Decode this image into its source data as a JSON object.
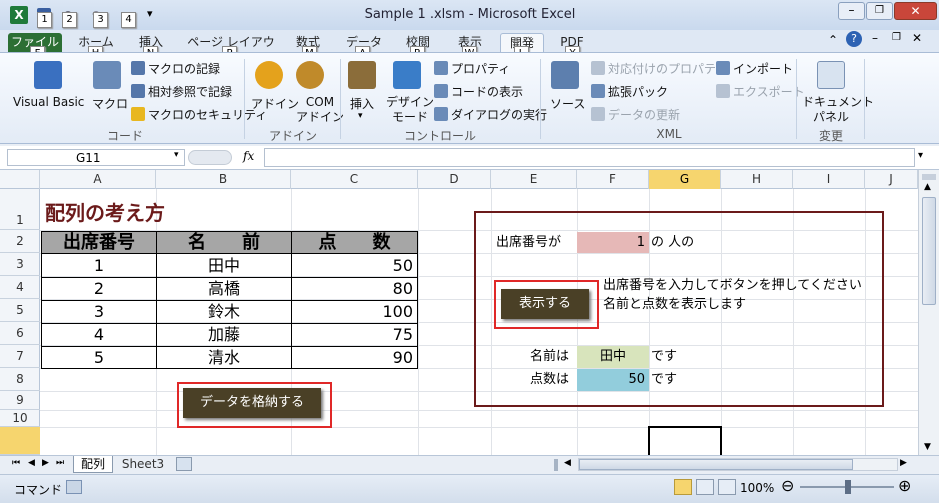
{
  "window": {
    "title": "Sample 1 .xlsm - Microsoft Excel",
    "quick_access_keys": [
      "1",
      "2",
      "3",
      "4"
    ]
  },
  "tabs": [
    {
      "label": "ファイル",
      "key": "F"
    },
    {
      "label": "ホーム",
      "key": "H"
    },
    {
      "label": "挿入",
      "key": "N"
    },
    {
      "label": "ページ レイアウト",
      "key": "P"
    },
    {
      "label": "数式",
      "key": "M"
    },
    {
      "label": "データ",
      "key": "A"
    },
    {
      "label": "校閲",
      "key": "R"
    },
    {
      "label": "表示",
      "key": "W"
    },
    {
      "label": "開発",
      "key": "L"
    },
    {
      "label": "PDF",
      "key": "Y"
    }
  ],
  "ribbon": {
    "code": {
      "group_label": "コード",
      "visual_basic": "Visual Basic",
      "macro": "マクロ",
      "record_macro": "マクロの記録",
      "relative_ref": "相対参照で記録",
      "macro_security": "マクロのセキュリティ"
    },
    "addin": {
      "group_label": "アドイン",
      "addin": "アドイン",
      "com_addin_1": "COM",
      "com_addin_2": "アドイン"
    },
    "control": {
      "group_label": "コントロール",
      "insert": "挿入",
      "design_mode_1": "デザイン",
      "design_mode_2": "モード",
      "properties": "プロパティ",
      "view_code": "コードの表示",
      "run_dialog": "ダイアログの実行"
    },
    "xml": {
      "group_label": "XML",
      "source": "ソース",
      "map_props": "対応付けのプロパティ",
      "expansion_pack": "拡張パック",
      "refresh_data": "データの更新",
      "import": "インポート",
      "export": "エクスポート"
    },
    "modify": {
      "group_label": "変更",
      "doc_panel_1": "ドキュメント",
      "doc_panel_2": "パネル"
    }
  },
  "formula_bar": {
    "name_box": "G11",
    "fx": "fx",
    "value": ""
  },
  "columns": [
    "A",
    "B",
    "C",
    "D",
    "E",
    "F",
    "G",
    "H",
    "I",
    "J"
  ],
  "rows": [
    "1",
    "2",
    "3",
    "4",
    "5",
    "6",
    "7",
    "8",
    "9",
    "10"
  ],
  "sheet": {
    "title": "配列の考え方",
    "headers": [
      "出席番号",
      "名　　前",
      "点　　数"
    ],
    "table": [
      [
        "1",
        "田中",
        "50"
      ],
      [
        "2",
        "高橋",
        "80"
      ],
      [
        "3",
        "鈴木",
        "100"
      ],
      [
        "4",
        "加藤",
        "75"
      ],
      [
        "5",
        "清水",
        "90"
      ]
    ],
    "store_button": "データを格納する",
    "panel": {
      "prompt_label": "出席番号が",
      "prompt_value": "1",
      "prompt_suffix": "の 人の",
      "show_button": "表示する",
      "instruction_1": "出席番号を入力してボタンを押してください",
      "instruction_2": "名前と点数を表示します",
      "name_label": "名前は",
      "name_value": "田中",
      "name_suffix": "です",
      "score_label": "点数は",
      "score_value": "50",
      "score_suffix": "です"
    }
  },
  "sheet_tabs": [
    "配列",
    "Sheet3"
  ],
  "status": {
    "mode": "コマンド",
    "zoom": "100%"
  },
  "colors": {
    "title_text": "#6b1a1a",
    "header_fill": "#a6a6a6",
    "panel_border": "#6b1a1a",
    "prompt_fill": "#e6b8b7",
    "name_fill": "#d8e4bc",
    "score_fill": "#92cddc",
    "button_fill": "#4a4026",
    "selected_header": "#f6d56e"
  }
}
